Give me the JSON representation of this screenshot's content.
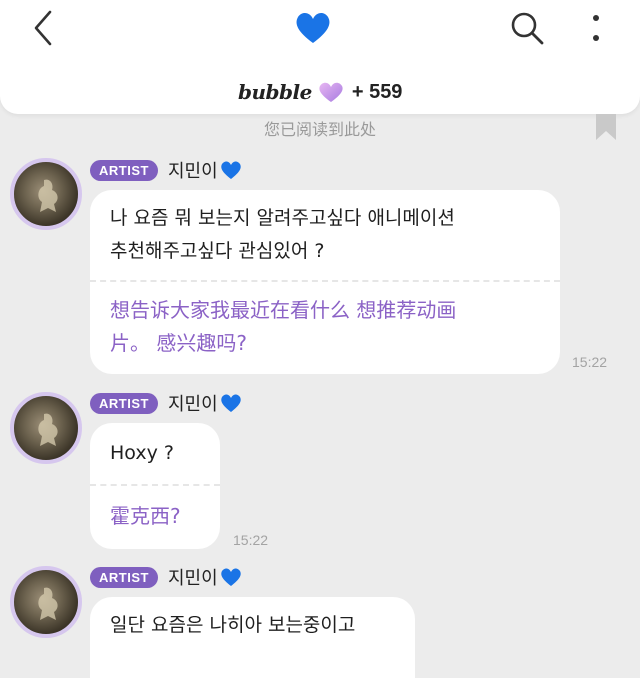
{
  "header": {
    "brand": "bubble",
    "subscriber_count": "+ 559",
    "heart_color": "#1a74e6",
    "brand_heart_color": "#c59be6"
  },
  "read_marker": "您已阅读到此处",
  "messages": [
    {
      "badge": "ARTIST",
      "sender": "지민이",
      "original": "나 요즘 뭐 보는지 알려주고싶다 애니메이션\n추천해주고싶다 관심있어 ?",
      "translation": "想告诉大家我最近在看什么 想推荐动画\n片。 感兴趣吗?",
      "time": "15:22"
    },
    {
      "badge": "ARTIST",
      "sender": "지민이",
      "original": "Hoxy ?",
      "translation": "霍克西?",
      "time": "15:22"
    },
    {
      "badge": "ARTIST",
      "sender": "지민이",
      "original": "일단 요즘은 나히아 보는중이고"
    }
  ]
}
